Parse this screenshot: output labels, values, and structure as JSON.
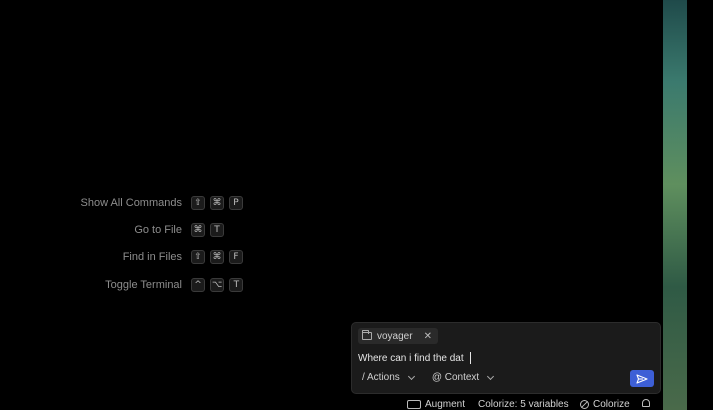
{
  "shortcuts": [
    {
      "label": "Show All Commands",
      "keys": [
        "⇧",
        "⌘",
        "P"
      ]
    },
    {
      "label": "Go to File",
      "keys": [
        "⌘",
        "T"
      ]
    },
    {
      "label": "Find in Files",
      "keys": [
        "⇧",
        "⌘",
        "F"
      ]
    },
    {
      "label": "Toggle Terminal",
      "keys": [
        "^",
        "⌥",
        "T"
      ]
    }
  ],
  "chat": {
    "context_chip": "voyager",
    "input_value": "Where can i find the dat",
    "actions_label": "/ Actions",
    "context_label": "@ Context"
  },
  "status_bar": {
    "augment": "Augment",
    "colorize_variables": "Colorize: 5 variables",
    "colorize": "Colorize"
  },
  "colors": {
    "accent": "#3d5fd6",
    "background": "#000000",
    "panel": "#1b1b1b"
  }
}
